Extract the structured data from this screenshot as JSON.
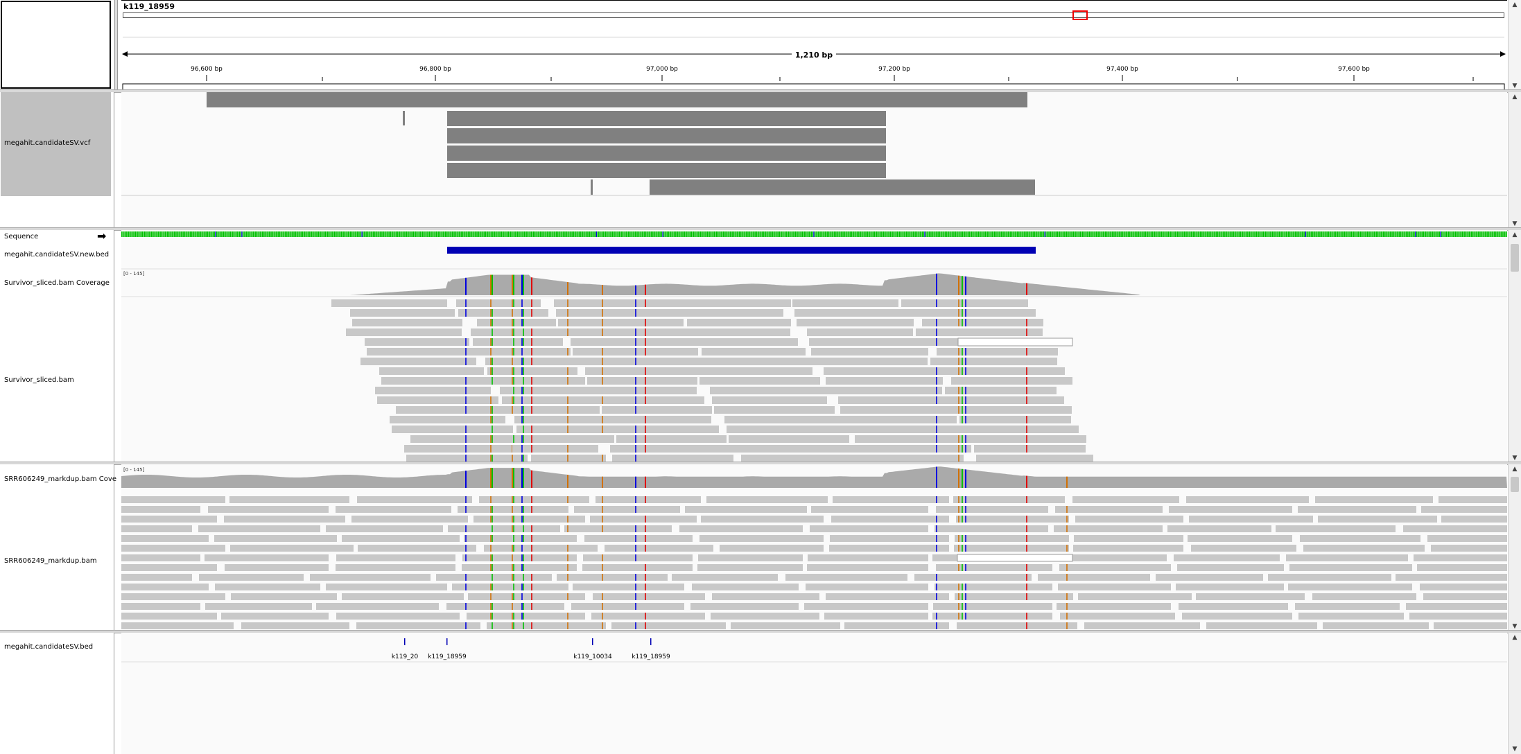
{
  "header": {
    "chromosome": "k119_18959",
    "span_label": "1,210 bp",
    "ruler_ticks": [
      "96,600 bp",
      "96,800 bp",
      "97,000 bp",
      "97,200 bp",
      "97,400 bp",
      "97,600 bp"
    ]
  },
  "tracks": {
    "vcf": "megahit.candidateSV.vcf",
    "sequence": "Sequence",
    "new_bed": "megahit.candidateSV.new.bed",
    "survivor_cov": "Survivor_sliced.bam Coverage",
    "survivor_cov_range": "[0 - 145]",
    "survivor_bam": "Survivor_sliced.bam",
    "srr_cov": "SRR606249_markdup.bam Cove",
    "srr_cov_range": "[0 - 145]",
    "srr_bam": "SRR606249_markdup.bam",
    "bed": "megahit.candidateSV.bed"
  },
  "bed_features": [
    "k119_20",
    "k119_18959",
    "k119_10034",
    "k119_18959"
  ],
  "colors": {
    "read": "#c8c8c8",
    "coverage": "#aaaaaa",
    "vcf_feature": "#808080",
    "bed_bar": "#0000b4",
    "mismatch_A": "#00c000",
    "mismatch_C": "#0000e0",
    "mismatch_G": "#d17105",
    "mismatch_T": "#e00000"
  }
}
